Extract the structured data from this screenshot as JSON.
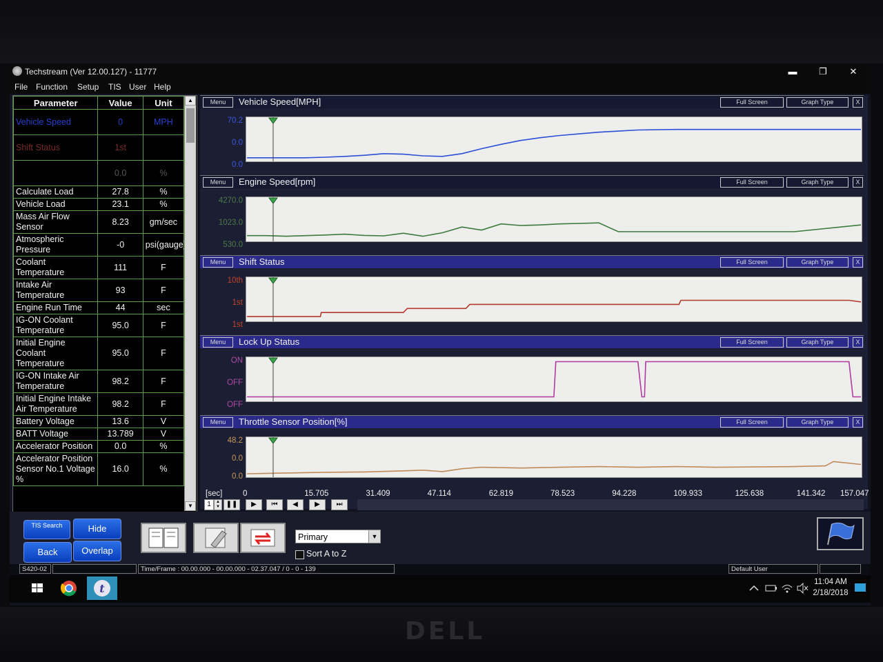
{
  "window": {
    "title": "Techstream (Ver 12.00.127) - 11777",
    "minimize": "▬",
    "maximize": "❐",
    "close": "✕"
  },
  "menu": [
    "File",
    "Function",
    "Setup",
    "TIS",
    "User",
    "Help"
  ],
  "param_table": {
    "headers": {
      "parameter": "Parameter",
      "value": "Value",
      "unit": "Unit"
    },
    "faded": [
      {
        "name": "Vehicle Speed",
        "value": "0",
        "unit": "MPH"
      },
      {
        "name": "Shift Status",
        "value": "1st",
        "unit": ""
      },
      {
        "name": "",
        "value": "0.0",
        "unit": "%"
      }
    ],
    "rows": [
      {
        "name": "Calculate Load",
        "value": "27.8",
        "unit": "%"
      },
      {
        "name": "Vehicle Load",
        "value": "23.1",
        "unit": "%"
      },
      {
        "name": "Mass Air Flow Sensor",
        "value": "8.23",
        "unit": "gm/sec"
      },
      {
        "name": "Atmospheric Pressure",
        "value": "-0",
        "unit": "psi(gauge)"
      },
      {
        "name": "Coolant Temperature",
        "value": "111",
        "unit": "F"
      },
      {
        "name": "Intake Air Temperature",
        "value": "93",
        "unit": "F"
      },
      {
        "name": "Engine Run Time",
        "value": "44",
        "unit": "sec"
      },
      {
        "name": "IG-ON Coolant Temperature",
        "value": "95.0",
        "unit": "F"
      },
      {
        "name": "Initial Engine Coolant Temperature",
        "value": "95.0",
        "unit": "F"
      },
      {
        "name": "IG-ON Intake Air Temperature",
        "value": "98.2",
        "unit": "F"
      },
      {
        "name": "Initial Engine Intake Air Temperature",
        "value": "98.2",
        "unit": "F"
      },
      {
        "name": "Battery Voltage",
        "value": "13.6",
        "unit": "V"
      },
      {
        "name": "BATT Voltage",
        "value": "13.789",
        "unit": "V"
      },
      {
        "name": "Accelerator Position",
        "value": "0.0",
        "unit": "%"
      },
      {
        "name": "Accelerator Position Sensor No.1 Voltage %",
        "value": "16.0",
        "unit": "%"
      }
    ]
  },
  "graph_buttons": {
    "menu": "Menu",
    "full_screen": "Full Screen",
    "graph_type": "Graph Type",
    "close": "X"
  },
  "chart_data": [
    {
      "type": "line",
      "title": "Vehicle Speed[MPH]",
      "y_labels": [
        "70.2",
        "0.0",
        "0.0"
      ],
      "color": "#2a4fd6",
      "x": [
        0,
        5,
        10,
        15,
        20,
        25,
        30,
        35,
        40,
        45,
        50,
        55,
        60,
        65,
        70,
        75,
        80,
        85,
        90,
        95,
        100,
        110,
        120,
        130,
        140,
        157.047
      ],
      "y": [
        1.5,
        1.5,
        1.5,
        1.5,
        2.5,
        4,
        6,
        9,
        8,
        5,
        4,
        9,
        18,
        26,
        33,
        38,
        42,
        45,
        48,
        50,
        52,
        53,
        53,
        53,
        53,
        53
      ],
      "ylim": [
        0,
        70.2
      ]
    },
    {
      "type": "line",
      "title": "Engine Speed[rpm]",
      "y_labels": [
        "4270.0",
        "1023.0",
        "530.0"
      ],
      "color": "#3a7a3a",
      "x": [
        0,
        5,
        10,
        15,
        20,
        25,
        30,
        35,
        40,
        45,
        50,
        55,
        60,
        65,
        70,
        75,
        80,
        85,
        90,
        95,
        100,
        110,
        120,
        130,
        140,
        157.047
      ],
      "y": [
        820,
        820,
        760,
        820,
        880,
        960,
        840,
        800,
        1050,
        760,
        1100,
        1650,
        1350,
        1950,
        1800,
        1850,
        1950,
        2000,
        2050,
        1200,
        1200,
        1200,
        1200,
        1200,
        1200,
        1850
      ],
      "ylim": [
        530,
        4270
      ]
    },
    {
      "type": "line",
      "title": "Shift Status",
      "y_labels": [
        "10th",
        "1st",
        "1st"
      ],
      "color": "#b23a2a",
      "x": [
        0,
        18.8,
        19,
        40,
        41,
        56,
        57,
        110.5,
        111,
        154,
        157.047
      ],
      "y": [
        1,
        1,
        2,
        2,
        3,
        3,
        4,
        4,
        5,
        5,
        4.6
      ],
      "ylim": [
        0.5,
        10
      ]
    },
    {
      "type": "line",
      "title": "Lock Up Status",
      "y_labels": [
        "ON",
        "OFF",
        "OFF"
      ],
      "color": "#b03aa0",
      "x": [
        0,
        78.5,
        79,
        100,
        101,
        101.7,
        102,
        154,
        155,
        157.047
      ],
      "y": [
        0,
        0,
        1,
        1,
        0,
        0,
        1,
        1,
        0,
        0
      ],
      "ylim": [
        -0.05,
        1.05
      ]
    },
    {
      "type": "line",
      "title": "Throttle Sensor Position[%]",
      "y_labels": [
        "48.2",
        "0.0",
        "0.0"
      ],
      "color": "#c08a5a",
      "x": [
        0,
        10,
        20,
        30,
        40,
        45,
        50,
        55,
        60,
        70,
        80,
        90,
        100,
        110,
        120,
        130,
        140,
        148,
        150,
        157.047
      ],
      "y": [
        1,
        2,
        3,
        3.5,
        5,
        6,
        4,
        8,
        10,
        9,
        10,
        11,
        10,
        11,
        10,
        10.5,
        11,
        12,
        18,
        14
      ],
      "ylim": [
        0,
        48.2
      ]
    }
  ],
  "x_axis": {
    "unit": "[sec]",
    "ticks": [
      "0",
      "15.705",
      "31.409",
      "47.114",
      "62.819",
      "78.523",
      "94.228",
      "109.933",
      "125.638",
      "141.342",
      "157.047"
    ],
    "max": 157.047
  },
  "cursor_x": 6.7,
  "playback": {
    "speed": "1",
    "buttons": [
      "pause",
      "play",
      "first",
      "prev",
      "next",
      "last"
    ]
  },
  "toolbar": {
    "tis_search": "TIS Search",
    "hide": "Hide",
    "back": "Back",
    "overlap": "Overlap",
    "dropdown_value": "Primary",
    "sort_label": "Sort A to Z"
  },
  "status": {
    "code": "S420-02",
    "time_frame": "Time/Frame : 00.00.000 - 00.00.000 - 02.37.047 / 0 - 0 - 139",
    "user": "Default User"
  },
  "taskbar": {
    "time": "11:04 AM",
    "date": "2/18/2018"
  }
}
